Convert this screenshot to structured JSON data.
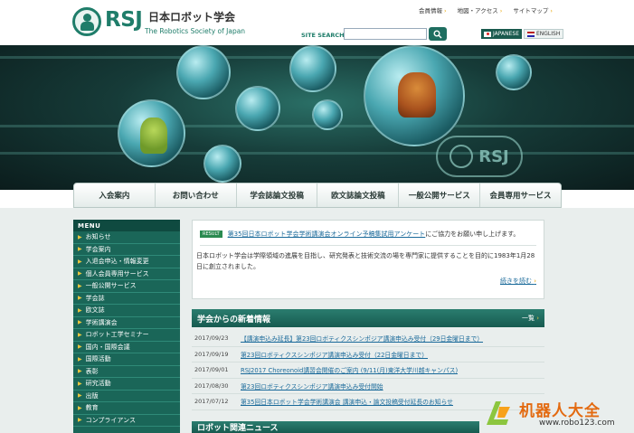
{
  "header": {
    "logo_text": "RSJ",
    "society_name_ja": "日本ロボット学会",
    "society_name_en": "The Robotics Society of Japan",
    "top_links": [
      "会員情報",
      "地図・アクセス",
      "サイトマップ"
    ],
    "search_label": "SITE SEARCH",
    "search_value": "",
    "lang_ja": "JAPANESE",
    "lang_en": "ENGLISH"
  },
  "hero": {
    "badge_text": "RSJ"
  },
  "main_nav": [
    {
      "label": "入会案内"
    },
    {
      "label": "お問い合わせ"
    },
    {
      "label": "学会誌論文投稿"
    },
    {
      "label": "欧文誌論文投稿"
    },
    {
      "label": "一般公開サービス"
    },
    {
      "label": "会員専用サービス"
    }
  ],
  "sidebar": {
    "title": "MENU",
    "items": [
      {
        "label": "お知らせ"
      },
      {
        "label": "学会案内"
      },
      {
        "label": "入退会申込・情報変更"
      },
      {
        "label": "個人会員専用サービス"
      },
      {
        "label": "一般公開サービス"
      },
      {
        "label": "学会誌"
      },
      {
        "label": "欧文誌"
      },
      {
        "label": "学術講演会"
      },
      {
        "label": "ロボット工学セミナー"
      },
      {
        "label": "国内・国際会議"
      },
      {
        "label": "国際活動"
      },
      {
        "label": "表彰"
      },
      {
        "label": "研究活動"
      },
      {
        "label": "出版"
      },
      {
        "label": "教育"
      },
      {
        "label": "コンプライアンス"
      }
    ]
  },
  "notice": {
    "badge": "RESULT",
    "link_text": "第35回日本ロボット学会学術講演会オンライン予稿集試用アンケート",
    "link_suffix": "にご協力をお願い申し上げます。",
    "description": "日本ロボット学会は学際領域の進展を目指し、研究発表と技術交流の場を専門家に提供することを目的に1983年1月28日に創立されました。",
    "more_label": "続きを読む"
  },
  "news": {
    "title": "学会からの新着情報",
    "all_label": "一覧",
    "items": [
      {
        "date": "2017/09/23",
        "text": "【講演申込み延長】第23回ロボティクスシンポジア講演申込み受付（29日金曜日まで）"
      },
      {
        "date": "2017/09/19",
        "text": "第23回ロボティクスシンポジア講演申込み受付（22日金曜日まで）"
      },
      {
        "date": "2017/09/01",
        "text": "RSJ2017 Choreonoid講習会開催のご案内 (9/11(月)東洋大学川越キャンパス)"
      },
      {
        "date": "2017/08/30",
        "text": "第23回ロボティクスシンポジア講演申込み受付開始"
      },
      {
        "date": "2017/07/12",
        "text": "第35回日本ロボット学会学術講演会 講演申込・論文投稿受付延長のお知らせ"
      }
    ]
  },
  "robot_news": {
    "title": "ロボット関連ニュース"
  },
  "watermark": {
    "name_cn": "机器人大全",
    "url": "www.robo123.com"
  },
  "colors": {
    "brand_green": "#1f7d6a",
    "sidebar_green": "#1a6658",
    "link_blue": "#1a6a9a",
    "accent_orange": "#e36a10"
  }
}
